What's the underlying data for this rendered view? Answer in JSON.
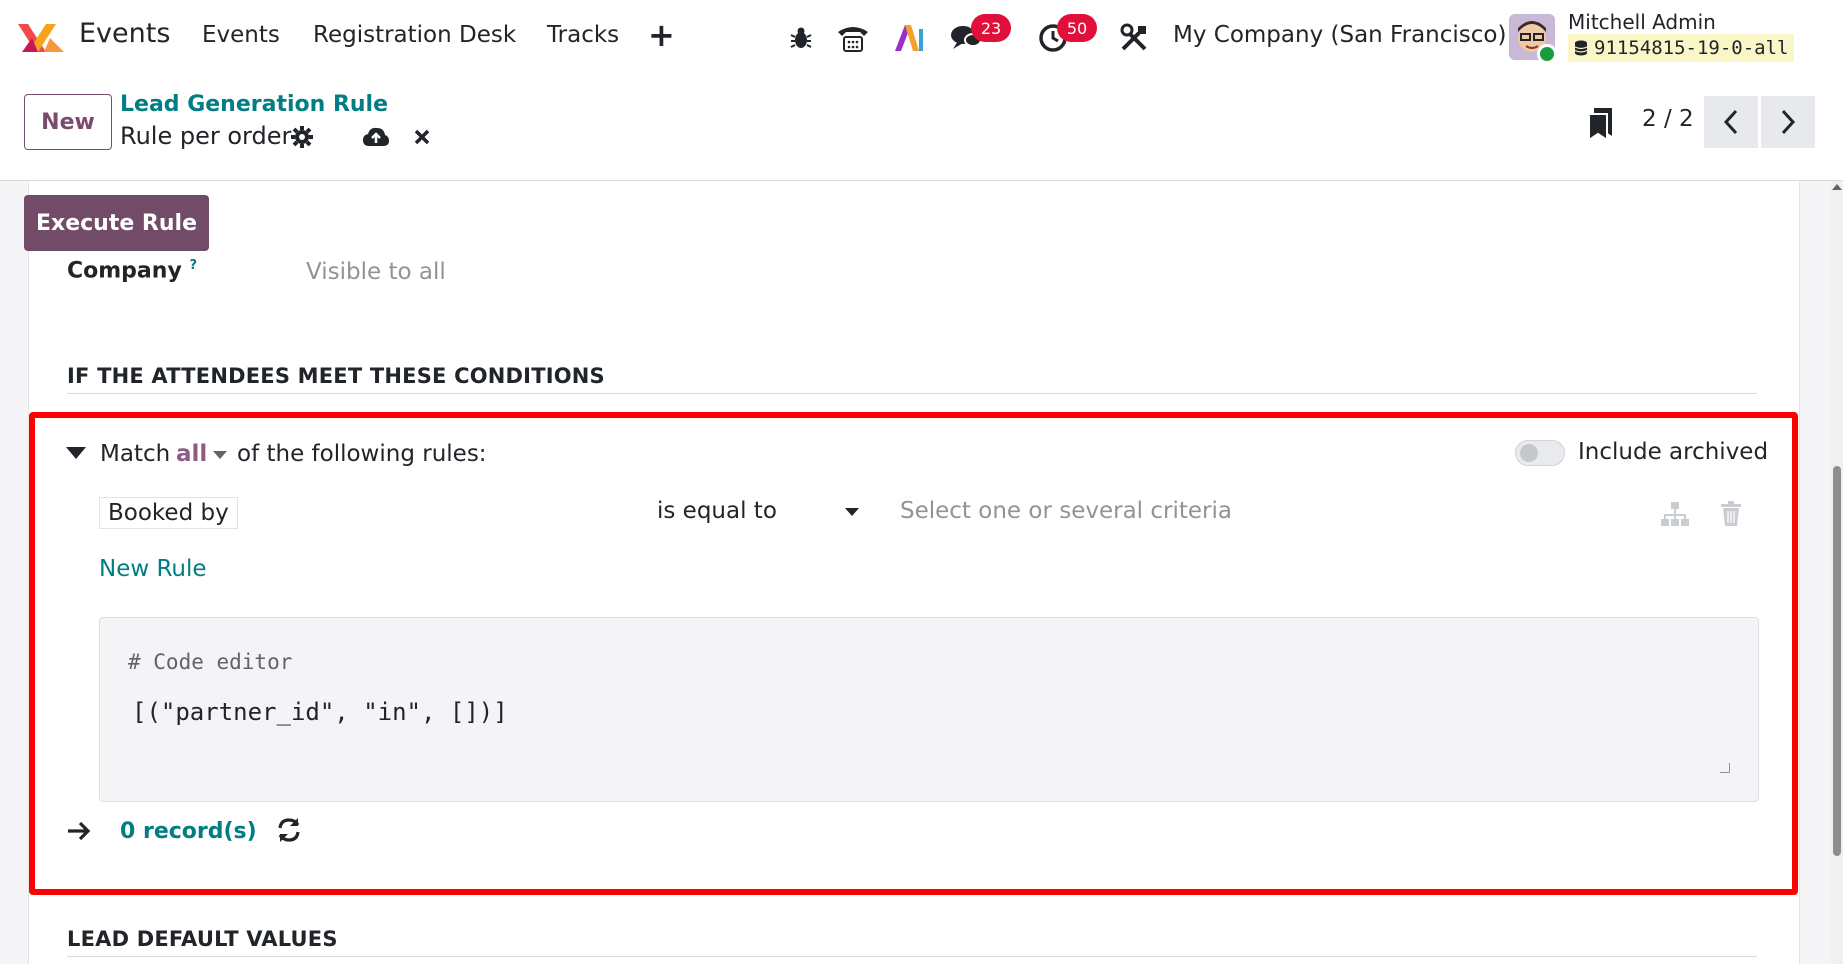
{
  "navbar": {
    "app_name": "Events",
    "menus": [
      "Events",
      "Registration Desk",
      "Tracks"
    ],
    "messages_count": "23",
    "activities_count": "50",
    "company": "My Company (San Francisco)",
    "user_name": "Mitchell Admin",
    "db_name": "91154815-19-0-all"
  },
  "control": {
    "new_label": "New",
    "breadcrumb_parent": "Lead Generation Rule",
    "breadcrumb_current": "Rule per order",
    "pager": "2 / 2"
  },
  "form": {
    "execute_label": "Execute Rule",
    "company_label": "Company",
    "company_help": "?",
    "company_value": "Visible to all",
    "section_conditions": "IF THE ATTENDEES MEET THESE CONDITIONS",
    "match_prefix": "Match",
    "match_mode": "all",
    "match_suffix": "of the following rules:",
    "include_archived_label": "Include archived",
    "rule": {
      "field": "Booked by",
      "operator": "is equal to",
      "value_placeholder": "Select one or several criteria"
    },
    "new_rule_label": "New Rule",
    "code_comment": "# Code editor",
    "code_domain": "[(\"partner_id\", \"in\", [])]",
    "records_label": "0 record(s)",
    "section_defaults": "LEAD DEFAULT VALUES"
  },
  "colors": {
    "brand": "#714b67",
    "link": "#017e84",
    "badge": "#e0103a",
    "highlight": "#ff0000"
  },
  "icons": [
    "bug-icon",
    "phone-icon",
    "ai-icon",
    "chat-icon",
    "clock-icon",
    "tools-icon",
    "gear-icon",
    "cloud-upload-icon",
    "close-icon",
    "bookmark-icon",
    "chevron-left-icon",
    "chevron-right-icon",
    "hierarchy-icon",
    "trash-icon",
    "arrow-right-icon",
    "refresh-icon",
    "database-icon"
  ]
}
